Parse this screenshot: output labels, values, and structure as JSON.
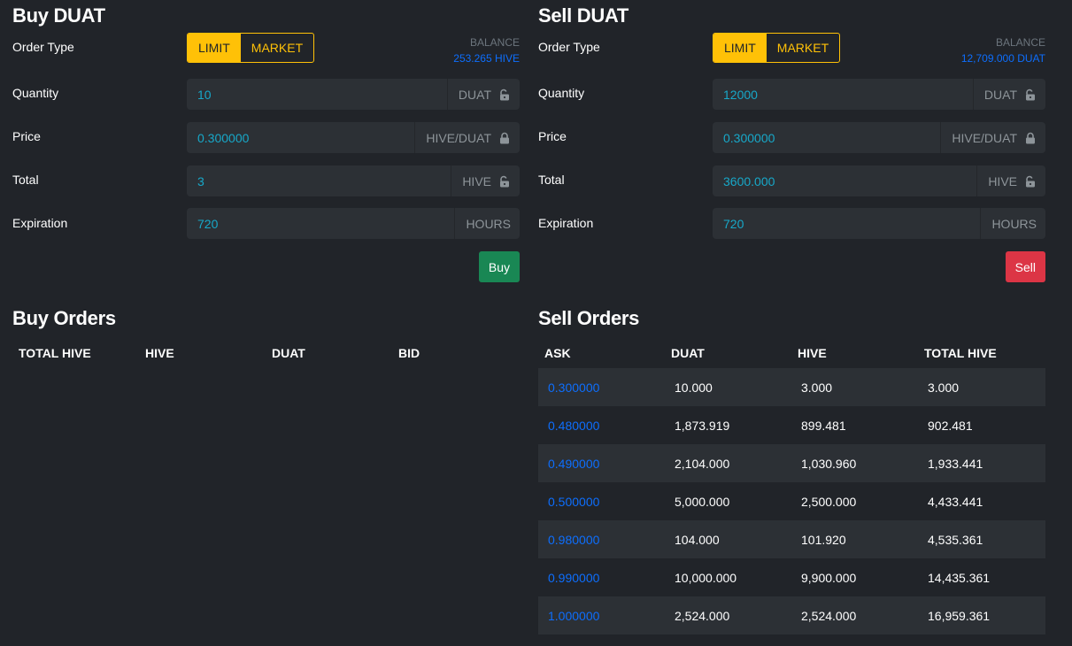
{
  "buy": {
    "title": "Buy DUAT",
    "order_type_label": "Order Type",
    "limit_label": "LIMIT",
    "market_label": "MARKET",
    "balance_label": "BALANCE",
    "balance_value": "253.265 HIVE",
    "quantity_label": "Quantity",
    "quantity_value": "10",
    "quantity_unit": "DUAT",
    "price_label": "Price",
    "price_value": "0.300000",
    "price_unit": "HIVE/DUAT",
    "total_label": "Total",
    "total_value": "3",
    "total_unit": "HIVE",
    "expiration_label": "Expiration",
    "expiration_value": "720",
    "expiration_unit": "HOURS",
    "button_label": "Buy"
  },
  "sell": {
    "title": "Sell DUAT",
    "order_type_label": "Order Type",
    "limit_label": "LIMIT",
    "market_label": "MARKET",
    "balance_label": "BALANCE",
    "balance_value": "12,709.000 DUAT",
    "quantity_label": "Quantity",
    "quantity_value": "12000",
    "quantity_unit": "DUAT",
    "price_label": "Price",
    "price_value": "0.300000",
    "price_unit": "HIVE/DUAT",
    "total_label": "Total",
    "total_value": "3600.000",
    "total_unit": "HIVE",
    "expiration_label": "Expiration",
    "expiration_value": "720",
    "expiration_unit": "HOURS",
    "button_label": "Sell"
  },
  "buy_orders": {
    "title": "Buy Orders",
    "columns": [
      "TOTAL HIVE",
      "HIVE",
      "DUAT",
      "BID"
    ],
    "rows": []
  },
  "sell_orders": {
    "title": "Sell Orders",
    "columns": [
      "ASK",
      "DUAT",
      "HIVE",
      "TOTAL HIVE"
    ],
    "rows": [
      [
        "0.300000",
        "10.000",
        "3.000",
        "3.000"
      ],
      [
        "0.480000",
        "1,873.919",
        "899.481",
        "902.481"
      ],
      [
        "0.490000",
        "2,104.000",
        "1,030.960",
        "1,933.441"
      ],
      [
        "0.500000",
        "5,000.000",
        "2,500.000",
        "4,433.441"
      ],
      [
        "0.980000",
        "104.000",
        "101.920",
        "4,535.361"
      ],
      [
        "0.990000",
        "10,000.000",
        "9,900.000",
        "14,435.361"
      ],
      [
        "1.000000",
        "2,524.000",
        "2,524.000",
        "16,959.361"
      ]
    ]
  },
  "colors": {
    "background": "#212429",
    "accent_yellow": "#ffc107",
    "buy_green": "#198754",
    "sell_red": "#dc3545",
    "link_blue": "#0d6efd",
    "input_text": "#17a8c9"
  },
  "icons": {
    "unlocked": "lock-open-icon",
    "locked": "lock-closed-icon"
  }
}
